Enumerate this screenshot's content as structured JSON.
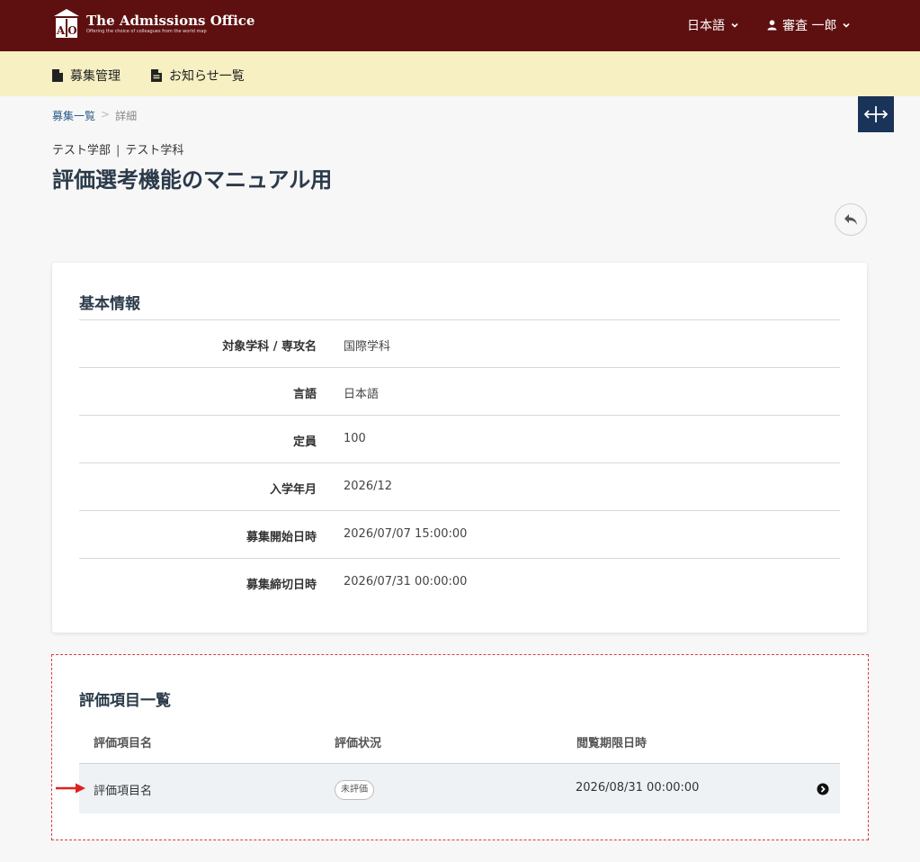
{
  "header": {
    "logo_title": "The Admissions Office",
    "logo_tagline": "Offering the choice of colleagues from the world map",
    "logo_letters": "AO",
    "language": "日本語",
    "user_name": "審査 一郎"
  },
  "subnav": {
    "items": [
      {
        "label": "募集管理",
        "icon": "document-icon"
      },
      {
        "label": "お知らせ一覧",
        "icon": "document-text-icon"
      }
    ]
  },
  "breadcrumb": {
    "items": [
      "募集一覧",
      "詳細"
    ],
    "separator": ">"
  },
  "page": {
    "faculty": "テスト学部",
    "department": "テスト学科",
    "divider": "|",
    "title": "評価選考機能のマニュアル用"
  },
  "basic_info": {
    "title": "基本情報",
    "rows": [
      {
        "label": "対象学科 / 専攻名",
        "value": "国際学科"
      },
      {
        "label": "言語",
        "value": "日本語"
      },
      {
        "label": "定員",
        "value": "100"
      },
      {
        "label": "入学年月",
        "value": "2026/12"
      },
      {
        "label": "募集開始日時",
        "value": "2026/07/07 15:00:00"
      },
      {
        "label": "募集締切日時",
        "value": "2026/07/31 00:00:00"
      }
    ]
  },
  "evaluation": {
    "title": "評価項目一覧",
    "columns": [
      "評価項目名",
      "評価状況",
      "閲覧期限日時"
    ],
    "rows": [
      {
        "name": "評価項目名",
        "status": "未評価",
        "deadline": "2026/08/31 00:00:00"
      }
    ]
  },
  "colors": {
    "header_bg": "#5e1010",
    "subnav_bg": "#f6f0c3",
    "expand_button_bg": "#1a3358",
    "highlight_border": "#e03a3a",
    "annotation_arrow": "#e02020"
  }
}
